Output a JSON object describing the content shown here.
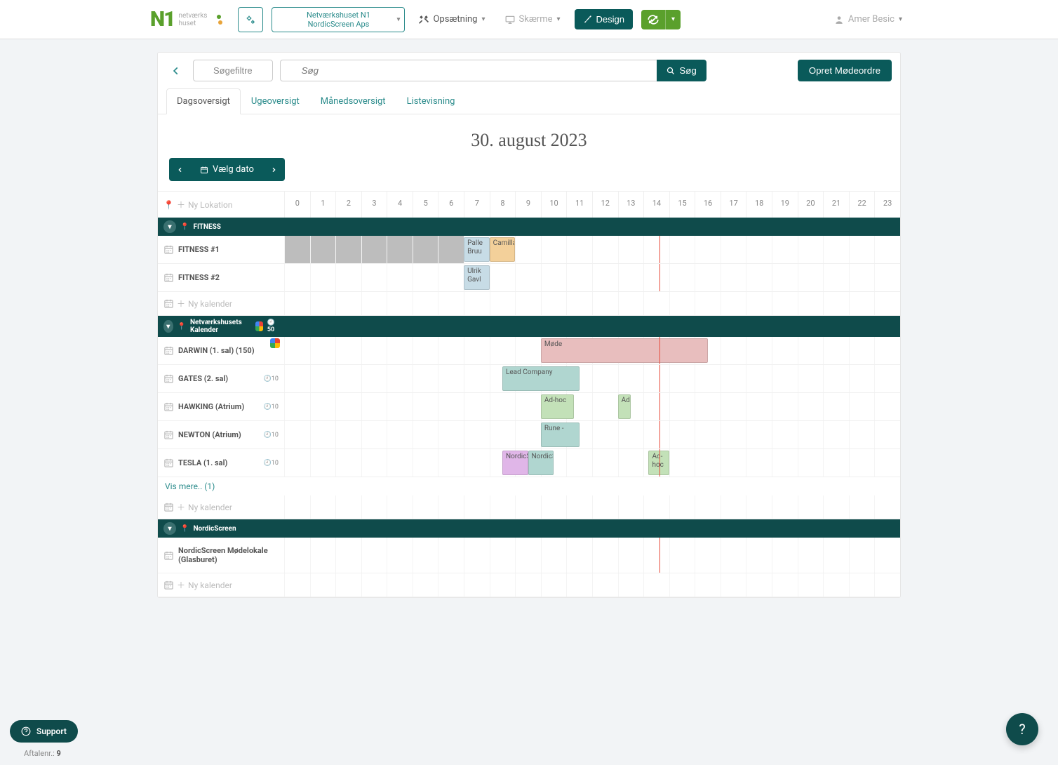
{
  "topbar": {
    "logo_text": "netværks\nhuset",
    "org_line1": "Netværkshuset N1",
    "org_line2": "NordicScreen Aps",
    "setup": "Opsætning",
    "screens": "Skærme",
    "design": "Design",
    "user": "Amer Besic"
  },
  "toolbar": {
    "filters": "Søgefiltre",
    "search_placeholder": "Søg",
    "search_btn": "Søg",
    "create": "Opret Mødeordre"
  },
  "tabs": [
    "Dagsoversigt",
    "Ugeoversigt",
    "Månedsoversigt",
    "Listevisning"
  ],
  "active_tab_index": 0,
  "date_title": "30. august 2023",
  "pick_date": "Vælg dato",
  "new_location": "Ny Lokation",
  "new_calendar": "Ny kalender",
  "show_more": "Vis mere.. (1)",
  "hours": [
    "0",
    "1",
    "2",
    "3",
    "4",
    "5",
    "6",
    "7",
    "8",
    "9",
    "10",
    "11",
    "12",
    "13",
    "14",
    "15",
    "16",
    "17",
    "18",
    "19",
    "20",
    "21",
    "22",
    "23"
  ],
  "now_percent": 60.9,
  "locations": [
    {
      "name": "FITNESS",
      "google": false,
      "rooms": [
        {
          "name": "FITNESS #1",
          "events": [
            {
              "label": "",
              "start": 0,
              "end": 7,
              "cls": "blocked"
            },
            {
              "label": "Palle Bruu",
              "start": 7,
              "end": 8,
              "cls": "ev-blue"
            },
            {
              "label": "Camilla",
              "start": 8,
              "end": 9,
              "cls": "ev-orange"
            }
          ]
        },
        {
          "name": "FITNESS #2",
          "events": [
            {
              "label": "Ulrik Gavl",
              "start": 7,
              "end": 8,
              "cls": "ev-blue"
            }
          ]
        }
      ]
    },
    {
      "name": "Netværkshusets Kalender",
      "google": true,
      "badge": "50",
      "rooms": [
        {
          "name": "DARWIN (1. sal) (150)",
          "gicon": true,
          "events": [
            {
              "label": "Møde",
              "start": 10,
              "end": 16.5,
              "cls": "ev-red"
            }
          ]
        },
        {
          "name": "GATES (2. sal)",
          "cap": "10",
          "events": [
            {
              "label": "Lead Company",
              "start": 8.5,
              "end": 11.5,
              "cls": "ev-teal"
            }
          ]
        },
        {
          "name": "HAWKING (Atrium)",
          "cap": "10",
          "events": [
            {
              "label": "Ad-hoc",
              "start": 10,
              "end": 11.3,
              "cls": "ev-green"
            },
            {
              "label": "Ad-",
              "start": 13,
              "end": 13.5,
              "cls": "ev-green"
            }
          ]
        },
        {
          "name": "NEWTON (Atrium)",
          "cap": "10",
          "events": [
            {
              "label": "Rune -",
              "start": 10,
              "end": 11.5,
              "cls": "ev-teal"
            }
          ]
        },
        {
          "name": "TESLA (1. sal)",
          "cap": "10",
          "events": [
            {
              "label": "NordicScr",
              "start": 8.5,
              "end": 9.5,
              "cls": "ev-purple"
            },
            {
              "label": "NordicScr",
              "start": 9.5,
              "end": 10.5,
              "cls": "ev-teal"
            },
            {
              "label": "Ad-hoc",
              "start": 14.2,
              "end": 15,
              "cls": "ev-green"
            }
          ]
        }
      ],
      "show_more": true
    },
    {
      "name": "NordicScreen",
      "google": false,
      "rooms": [
        {
          "name": "NordicScreen Mødelokale (Glasburet)",
          "events": []
        }
      ]
    }
  ],
  "support": "Support",
  "footer_label": "Aftalenr.: ",
  "footer_value": "9"
}
